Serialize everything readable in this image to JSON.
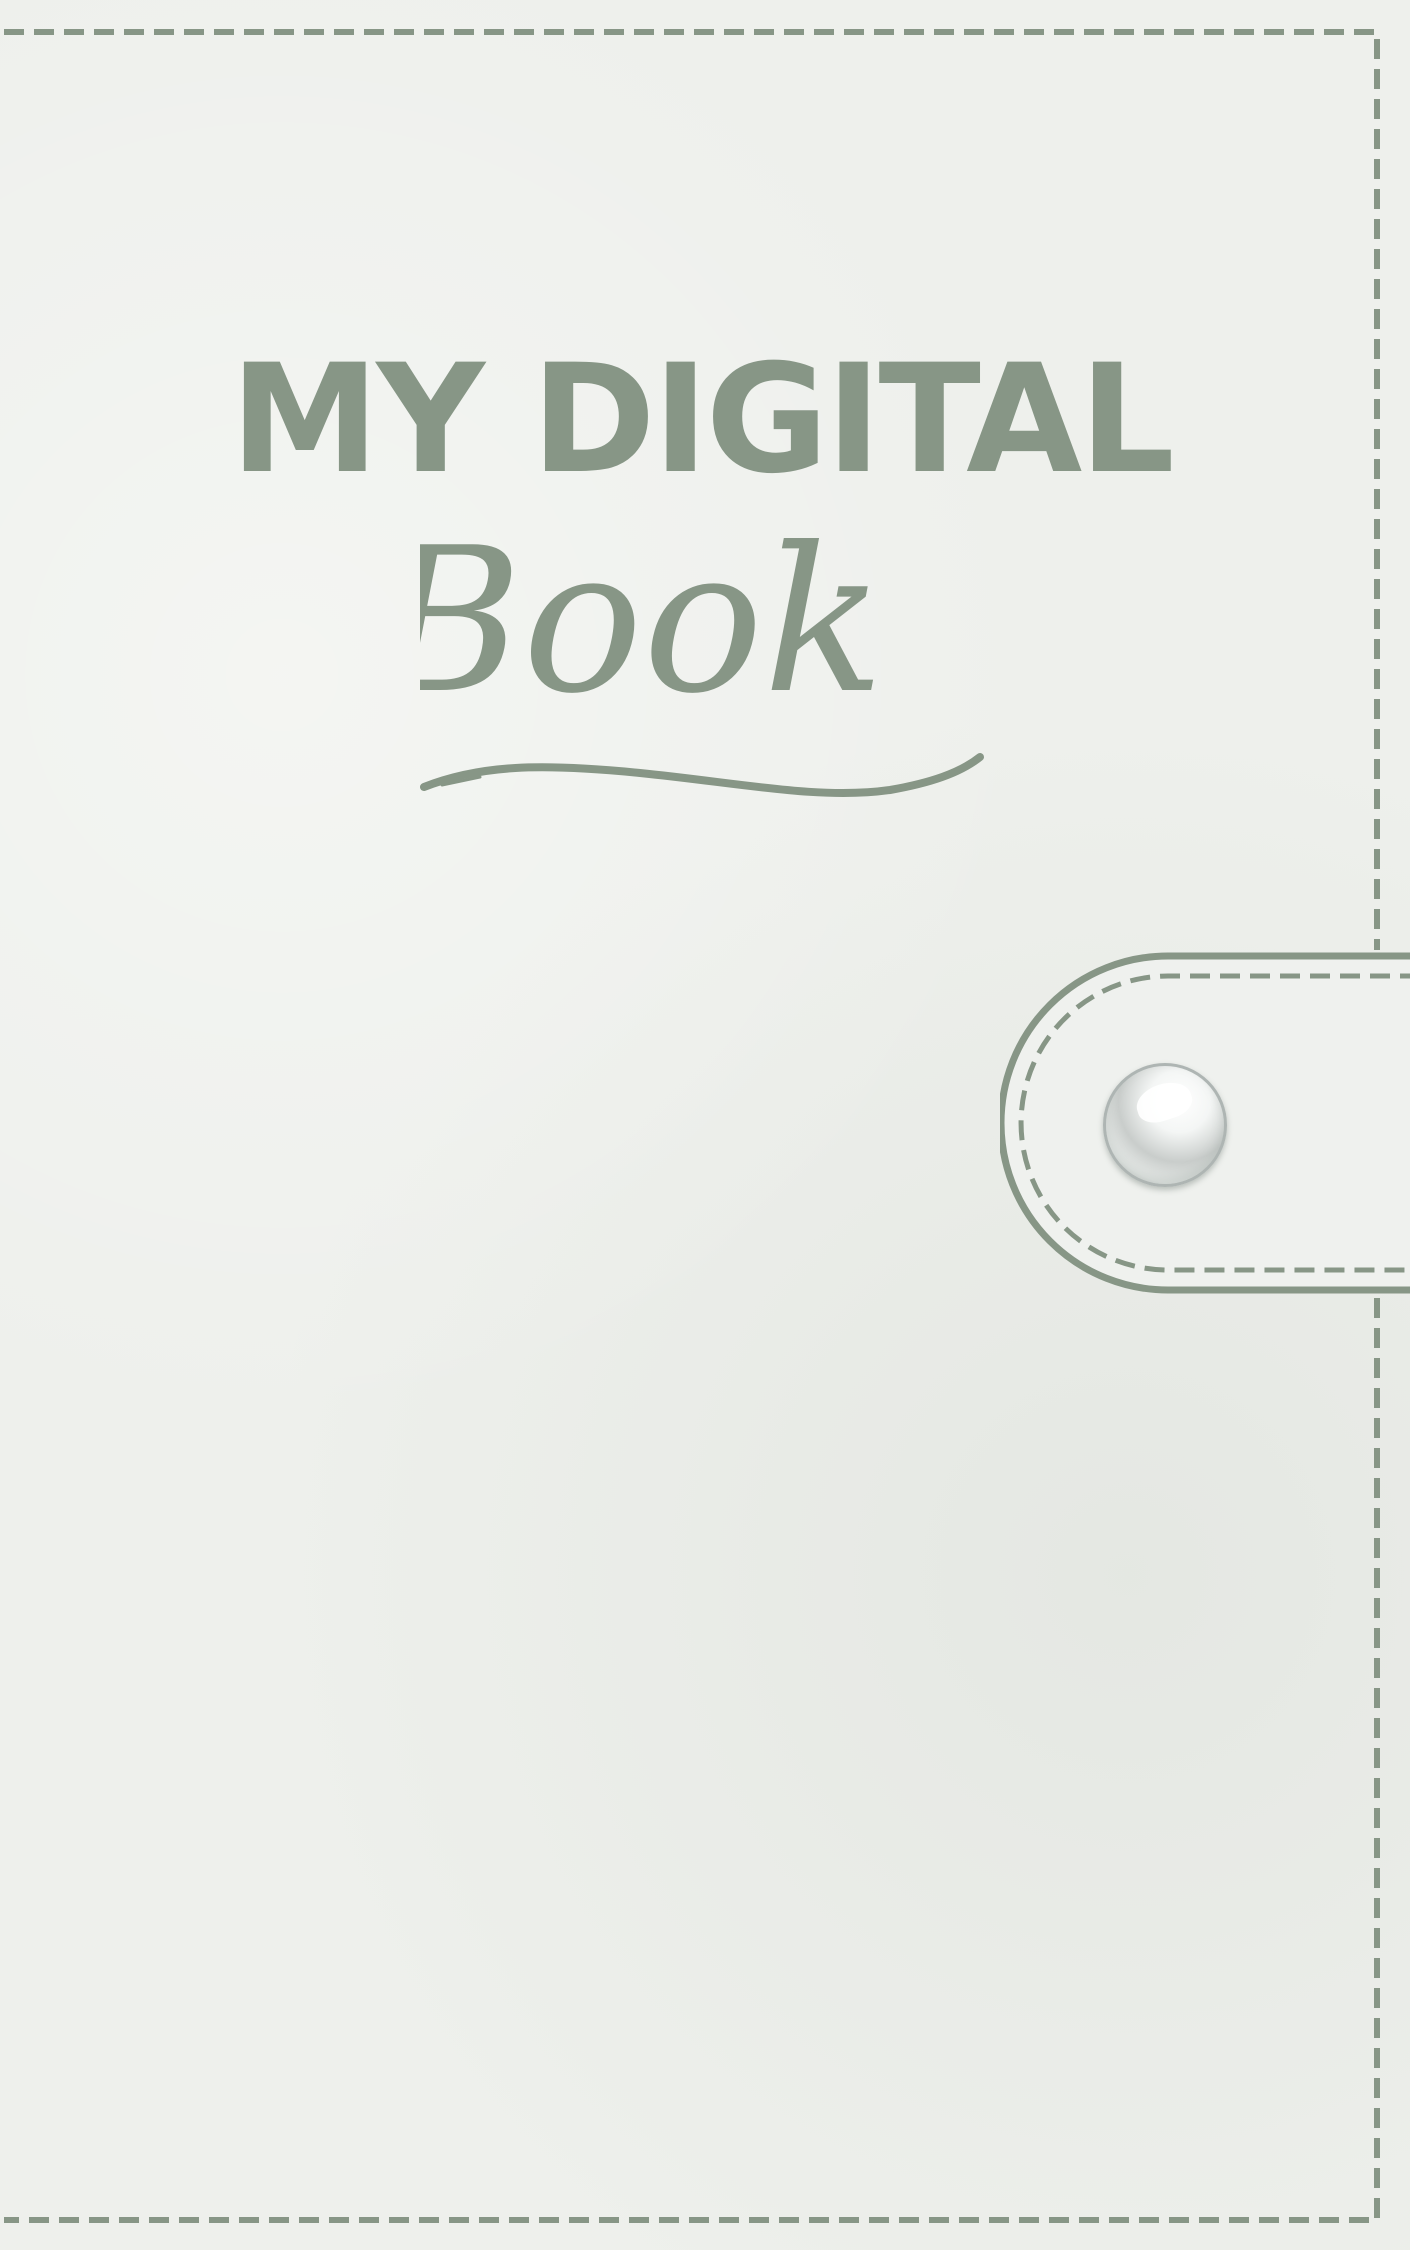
{
  "cover": {
    "title_line1": "MY DIGITAL",
    "title_line2": "Book"
  },
  "colors": {
    "background": "#eef0ec",
    "accent": "#879686",
    "stitch": "#879686",
    "strap_fill": "#eff1ee"
  },
  "icons": {
    "snap": "snap-button-icon",
    "underline": "flourish-underline"
  }
}
